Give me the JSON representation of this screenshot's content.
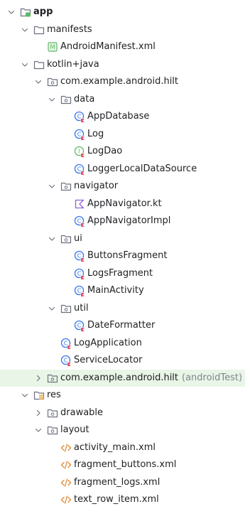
{
  "colors": {
    "folder": "#6c707e",
    "class": "#3574f0",
    "class_badge": "#e55765",
    "interface": "#5fb865",
    "manifest": "#5fb865",
    "kotlin_file": "#8c62d6",
    "xml": "#e08a31",
    "resource_folder": "#e0a239",
    "module_badge": "#5fb865",
    "highlight_row": "#e9f5e6",
    "text": "#1e1f22",
    "secondary_text": "#818594"
  },
  "tree": [
    {
      "label": "app",
      "depth": 0,
      "expanded": true,
      "icon": "module-folder-icon",
      "bold": true
    },
    {
      "label": "manifests",
      "depth": 1,
      "expanded": true,
      "icon": "folder-icon"
    },
    {
      "label": "AndroidManifest.xml",
      "depth": 2,
      "icon": "manifest-icon"
    },
    {
      "label": "kotlin+java",
      "depth": 1,
      "expanded": true,
      "icon": "folder-icon"
    },
    {
      "label": "com.example.android.hilt",
      "depth": 2,
      "expanded": true,
      "icon": "package-icon"
    },
    {
      "label": "data",
      "depth": 3,
      "expanded": true,
      "icon": "package-icon"
    },
    {
      "label": "AppDatabase",
      "depth": 4,
      "icon": "kotlin-class-icon"
    },
    {
      "label": "Log",
      "depth": 4,
      "icon": "kotlin-class-icon"
    },
    {
      "label": "LogDao",
      "depth": 4,
      "icon": "kotlin-interface-icon"
    },
    {
      "label": "LoggerLocalDataSource",
      "depth": 4,
      "icon": "kotlin-class-icon"
    },
    {
      "label": "navigator",
      "depth": 3,
      "expanded": true,
      "icon": "package-icon"
    },
    {
      "label": "AppNavigator.kt",
      "depth": 4,
      "icon": "kotlin-file-icon"
    },
    {
      "label": "AppNavigatorImpl",
      "depth": 4,
      "icon": "kotlin-class-icon"
    },
    {
      "label": "ui",
      "depth": 3,
      "expanded": true,
      "icon": "package-icon"
    },
    {
      "label": "ButtonsFragment",
      "depth": 4,
      "icon": "kotlin-class-icon"
    },
    {
      "label": "LogsFragment",
      "depth": 4,
      "icon": "kotlin-class-icon"
    },
    {
      "label": "MainActivity",
      "depth": 4,
      "icon": "kotlin-class-icon"
    },
    {
      "label": "util",
      "depth": 3,
      "expanded": true,
      "icon": "package-icon"
    },
    {
      "label": "DateFormatter",
      "depth": 4,
      "icon": "kotlin-class-icon"
    },
    {
      "label": "LogApplication",
      "depth": 3,
      "icon": "kotlin-class-icon"
    },
    {
      "label": "ServiceLocator",
      "depth": 3,
      "icon": "kotlin-class-icon"
    },
    {
      "label": "com.example.android.hilt",
      "suffix": "(androidTest)",
      "depth": 2,
      "expanded": false,
      "icon": "package-icon",
      "highlight": true
    },
    {
      "label": "res",
      "depth": 1,
      "expanded": true,
      "icon": "resource-folder-icon"
    },
    {
      "label": "drawable",
      "depth": 2,
      "expanded": false,
      "icon": "package-icon"
    },
    {
      "label": "layout",
      "depth": 2,
      "expanded": true,
      "icon": "package-icon"
    },
    {
      "label": "activity_main.xml",
      "depth": 3,
      "icon": "xml-file-icon"
    },
    {
      "label": "fragment_buttons.xml",
      "depth": 3,
      "icon": "xml-file-icon"
    },
    {
      "label": "fragment_logs.xml",
      "depth": 3,
      "icon": "xml-file-icon"
    },
    {
      "label": "text_row_item.xml",
      "depth": 3,
      "icon": "xml-file-icon"
    }
  ]
}
